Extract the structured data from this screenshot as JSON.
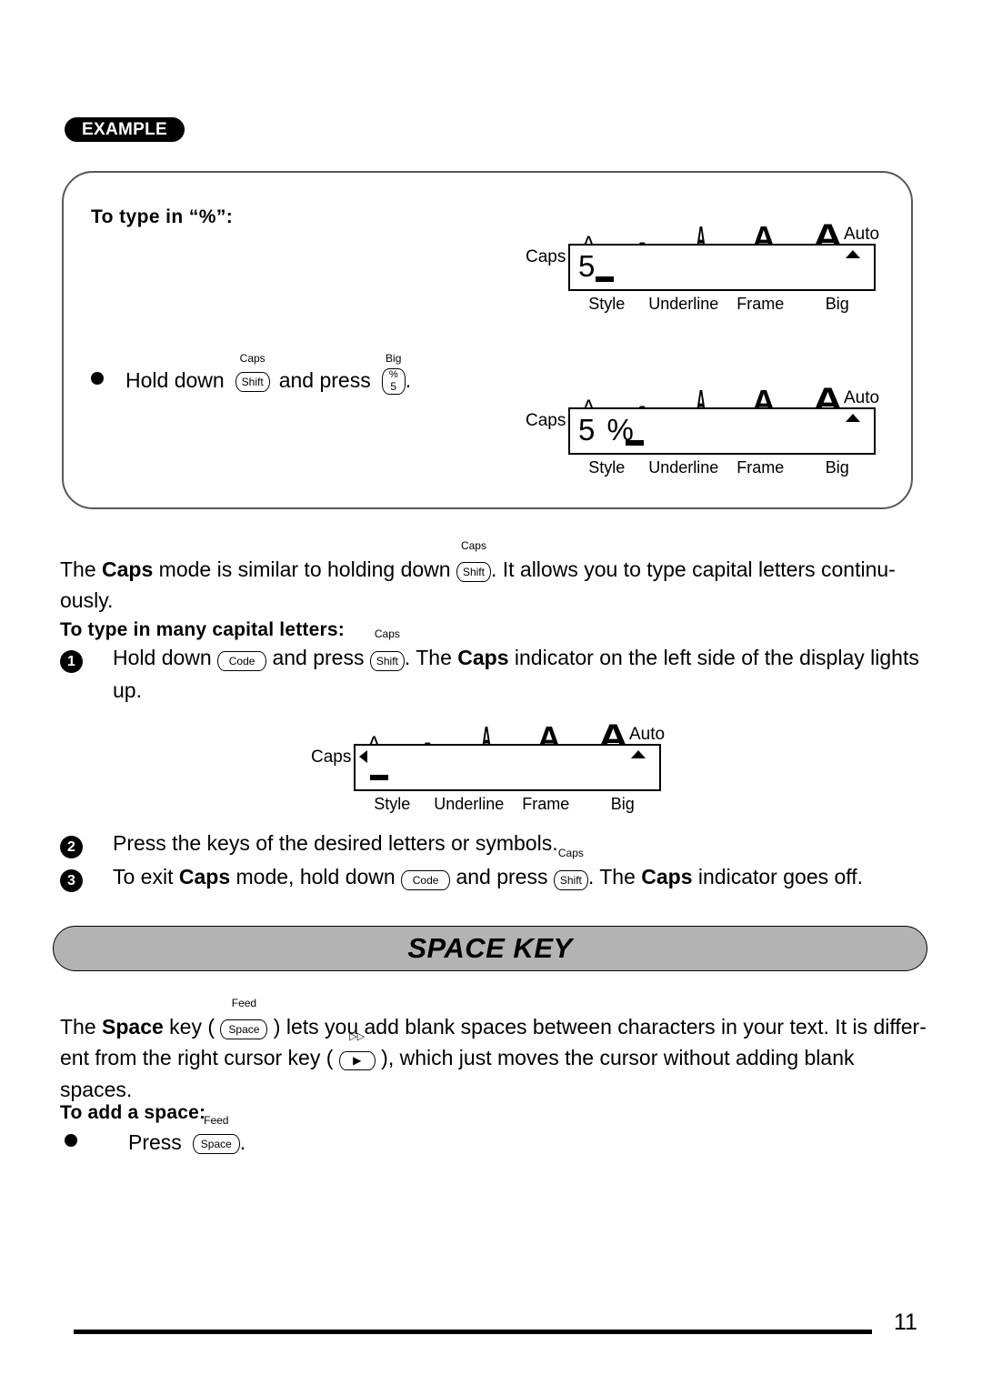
{
  "page": {
    "number": "11"
  },
  "example": {
    "badge": "EXAMPLE",
    "heading": "To type in “%”:",
    "step": {
      "text_before": "Hold down",
      "text_middle": "and press",
      "text_after": "."
    }
  },
  "keys": {
    "shift": {
      "top": "Caps",
      "label": "Shift"
    },
    "code": {
      "top": "",
      "label": "Code"
    },
    "space": {
      "top": "Feed",
      "label": "Space"
    },
    "percent": {
      "top": "Big",
      "label": "%",
      "label2": "5"
    },
    "cursor_right": {
      "top": "▷▷",
      "label": "▶"
    }
  },
  "lcd": {
    "caps_label": "Caps",
    "auto_label": "Auto",
    "a_glyphs": [
      "A",
      "A",
      "A",
      "A",
      "A"
    ],
    "bottom_labels": [
      "Style",
      "Underline",
      "Frame",
      "Big"
    ],
    "displays": [
      {
        "text": "5",
        "cursor": true,
        "caps_on": false
      },
      {
        "text": "5 %",
        "cursor": true,
        "caps_on": false
      },
      {
        "text": "",
        "cursor": true,
        "caps_on": true
      }
    ]
  },
  "caps_section": {
    "paragraph": {
      "p1": "The ",
      "b1": "Caps",
      "p2": " mode is similar to holding down ",
      "p3": ". It allows you to type capital letters continu-",
      "p4": "ously."
    },
    "sub_heading": "To type in many capital letters:",
    "steps": [
      {
        "number": "❶",
        "p1": "Hold down ",
        "p2": " and press ",
        "p3": ". The ",
        "b1": "Caps",
        "p4": " indicator on the left side of the display lights",
        "p5": "up."
      },
      {
        "number": "❷",
        "p1": "Press the keys of the desired letters or symbols."
      },
      {
        "number": "❸",
        "p1": "To exit ",
        "b1": "Caps",
        "p2": " mode, hold down ",
        "p3": " and press ",
        "p4": ". The ",
        "b2": "Caps",
        "p5": " indicator goes off."
      }
    ]
  },
  "space_section": {
    "banner_title": "SPACE KEY",
    "paragraph": {
      "p1": "The ",
      "b1": "Space",
      "p2": " key ( ",
      "p3": " ) lets you add blank spaces between characters in your text. It is differ-",
      "p4": "ent from the right cursor key ( ",
      "p5": " ), which just moves the cursor without adding blank",
      "p6": "spaces."
    },
    "sub_heading": "To add a space:",
    "step": {
      "text_before": "Press",
      "text_after": "."
    }
  }
}
